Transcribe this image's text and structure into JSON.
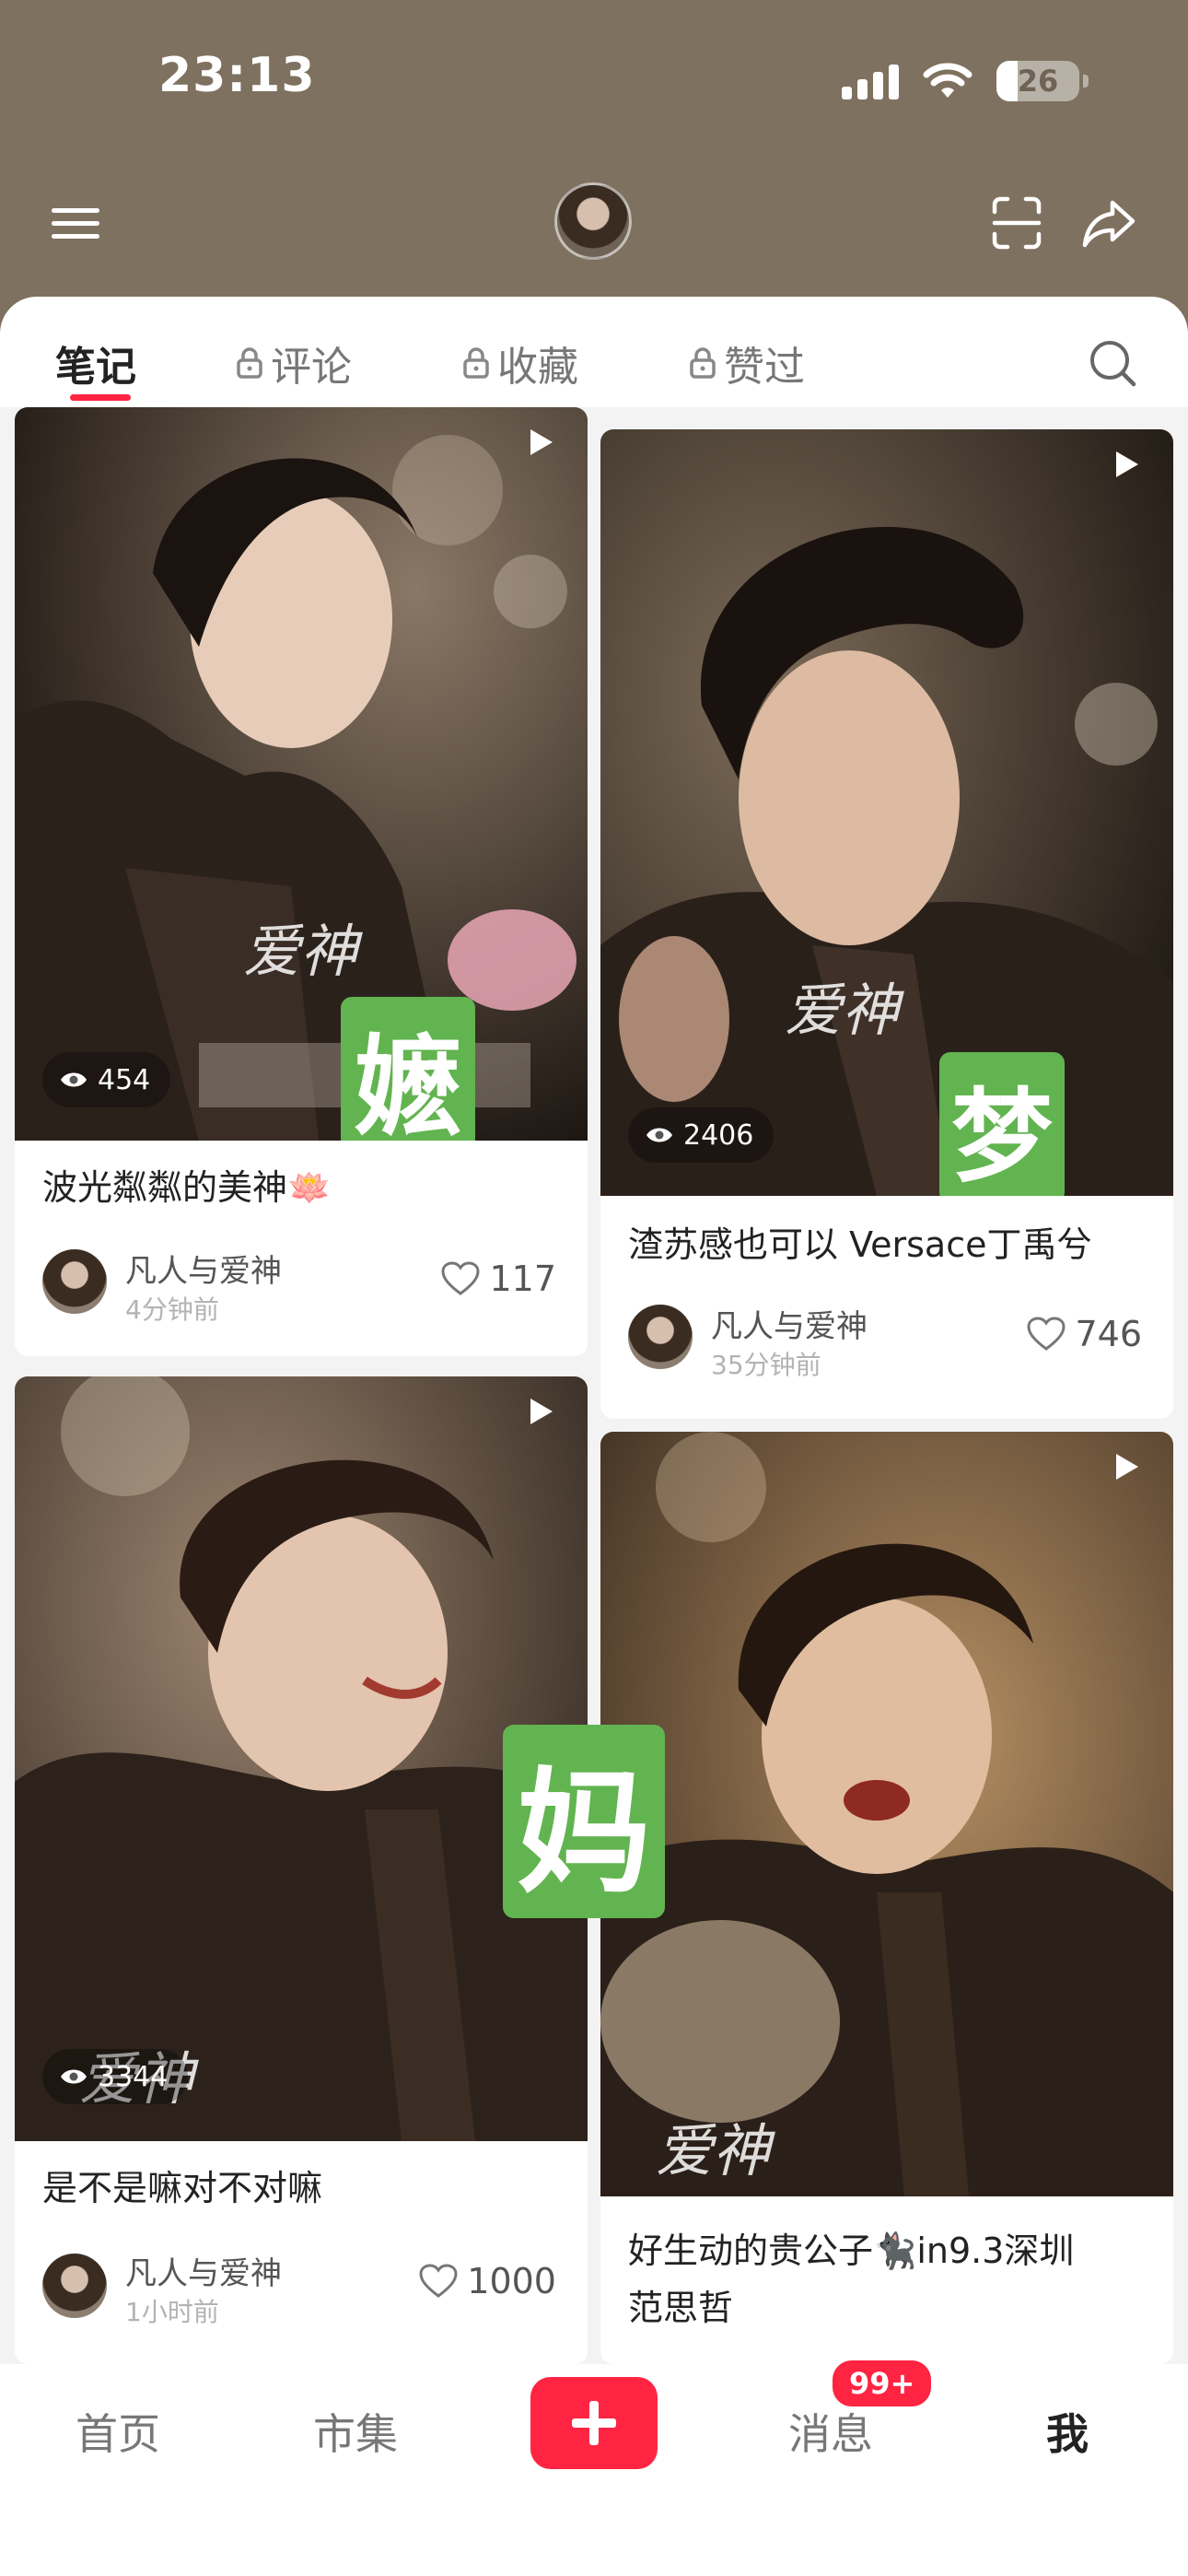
{
  "status_bar": {
    "time": "23:13",
    "battery": "26"
  },
  "header": {
    "icons": [
      "menu-icon",
      "avatar",
      "scan-icon",
      "share-icon"
    ]
  },
  "tabs": [
    {
      "label": "笔记",
      "active": true,
      "locked": false
    },
    {
      "label": "评论",
      "active": false,
      "locked": true
    },
    {
      "label": "收藏",
      "active": false,
      "locked": true
    },
    {
      "label": "赞过",
      "active": false,
      "locked": true
    }
  ],
  "cards": [
    {
      "views": "454",
      "watermark": "爱神",
      "sticker": "嬷",
      "title": "波光粼粼的美神🪷",
      "author": "凡人与爱神",
      "time": "4分钟前",
      "likes": "117"
    },
    {
      "views": "2406",
      "watermark": "爱神",
      "sticker": "梦",
      "title": "渣苏感也可以 Versace丁禹兮",
      "author": "凡人与爱神",
      "time": "35分钟前",
      "likes": "746"
    },
    {
      "views": "3344",
      "watermark": "爱神",
      "sticker": "妈",
      "title": "是不是嘛对不对嘛",
      "author": "凡人与爱神",
      "time": "1小时前",
      "likes": "1000"
    },
    {
      "views": "",
      "watermark": "爱神",
      "title_line1": "好生动的贵公子🐈‍⬛in9.3深圳",
      "title_line2": "范思哲"
    }
  ],
  "bottom_nav": {
    "home": "首页",
    "market": "市集",
    "messages": "消息",
    "messages_badge": "99+",
    "me": "我"
  },
  "colors": {
    "header_bg": "#7f715f",
    "accent": "#ff2442",
    "sticker_green": "#62b450"
  }
}
